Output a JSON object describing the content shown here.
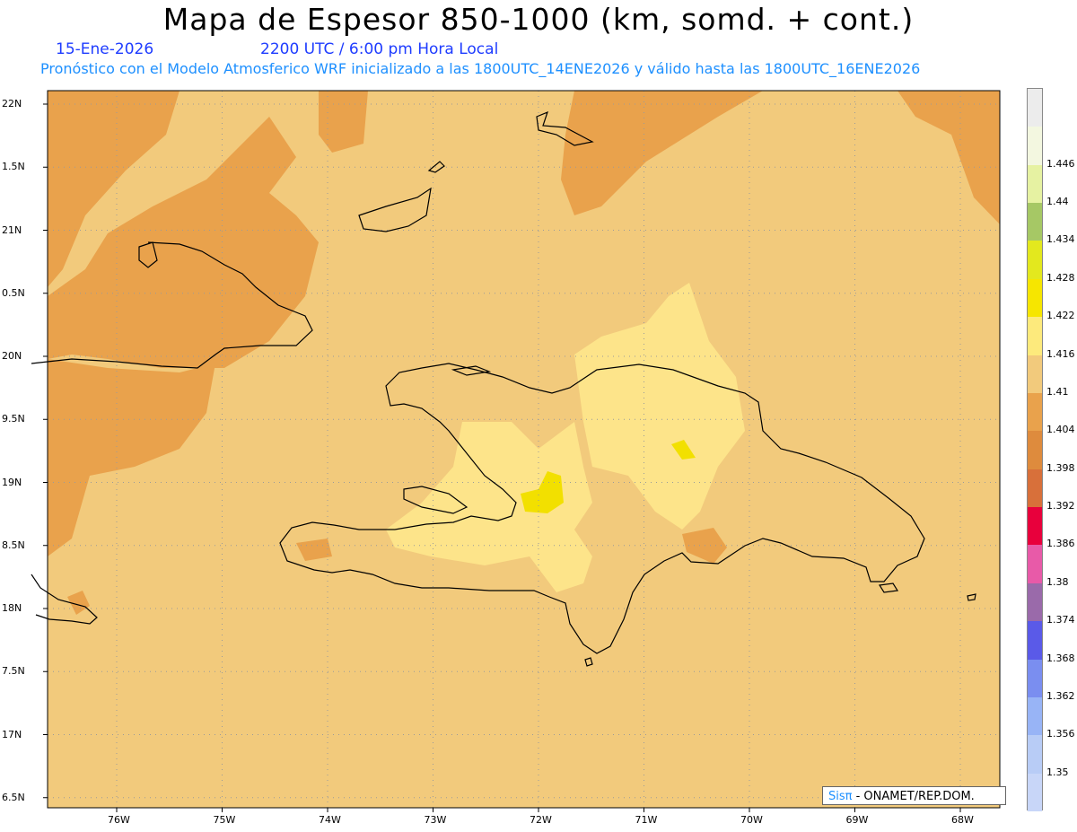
{
  "header": {
    "title": "Mapa de Espesor 850-1000 (km, somd. + cont.)",
    "date": "15-Ene-2026",
    "time": "2200 UTC / 6:00 pm Hora Local",
    "subtitle": "Pronóstico con el Modelo Atmosferico WRF inicializado a las 1800UTC_14ENE2026 y válido hasta las  1800UTC_16ENE2026"
  },
  "credit": {
    "logo_text": "Sisπ",
    "org": " - ONAMET/REP.DOM."
  },
  "map": {
    "lon_range": [
      -76.67,
      -67.63
    ],
    "lat_range": [
      17.87,
      22.0
    ],
    "lat_ticks": [
      {
        "value": 22.0,
        "label": "22N"
      },
      {
        "value": 21.5,
        "label": "1.5N"
      },
      {
        "value": 21.0,
        "label": "21N"
      },
      {
        "value": 20.5,
        "label": "0.5N"
      },
      {
        "value": 20.0,
        "label": "20N"
      },
      {
        "value": 19.5,
        "label": "9.5N"
      },
      {
        "value": 19.0,
        "label": "19N"
      },
      {
        "value": 18.5,
        "label": "8.5N"
      },
      {
        "value": 18.0,
        "label": "18N"
      },
      {
        "value": 17.5,
        "label": "7.5N"
      },
      {
        "value": 17.0,
        "label": "17N"
      },
      {
        "value": 16.5,
        "label": "6.5N"
      }
    ],
    "lon_ticks": [
      {
        "value": -76,
        "label": "76W"
      },
      {
        "value": -75,
        "label": "75W"
      },
      {
        "value": -74,
        "label": "74W"
      },
      {
        "value": -73,
        "label": "73W"
      },
      {
        "value": -72,
        "label": "72W"
      },
      {
        "value": -71,
        "label": "71W"
      },
      {
        "value": -70,
        "label": "70W"
      },
      {
        "value": -69,
        "label": "69W"
      },
      {
        "value": -68,
        "label": "68W"
      }
    ],
    "colors": {
      "background_field": "#f2ca7c",
      "darker_field": "#e9a24c",
      "lighter_field": "#fde48a",
      "peak_field": "#f2e000",
      "coast": "#000000",
      "grid": "#9a9a9a"
    }
  },
  "colorbar": {
    "levels": [
      {
        "label": "",
        "color": "#ececec"
      },
      {
        "label": "1.446",
        "color": "#f3f7e0"
      },
      {
        "label": "1.44",
        "color": "#e6f2a2"
      },
      {
        "label": "1.434",
        "color": "#a6c865"
      },
      {
        "label": "1.428",
        "color": "#e3e81e"
      },
      {
        "label": "1.422",
        "color": "#f6e600"
      },
      {
        "label": "1.416",
        "color": "#fdea7c"
      },
      {
        "label": "1.41",
        "color": "#f2ca7c"
      },
      {
        "label": "1.404",
        "color": "#e9a24c"
      },
      {
        "label": "1.398",
        "color": "#de8b3d"
      },
      {
        "label": "1.392",
        "color": "#d8703a"
      },
      {
        "label": "1.386",
        "color": "#e8003c"
      },
      {
        "label": "1.38",
        "color": "#e85aa8"
      },
      {
        "label": "1.374",
        "color": "#9a6aaa"
      },
      {
        "label": "1.368",
        "color": "#5a5ae8"
      },
      {
        "label": "1.362",
        "color": "#7a8ef0"
      },
      {
        "label": "1.356",
        "color": "#98b4f6"
      },
      {
        "label": "1.35",
        "color": "#b8ccf6"
      },
      {
        "label": "",
        "color": "#c8d6f8"
      }
    ]
  }
}
